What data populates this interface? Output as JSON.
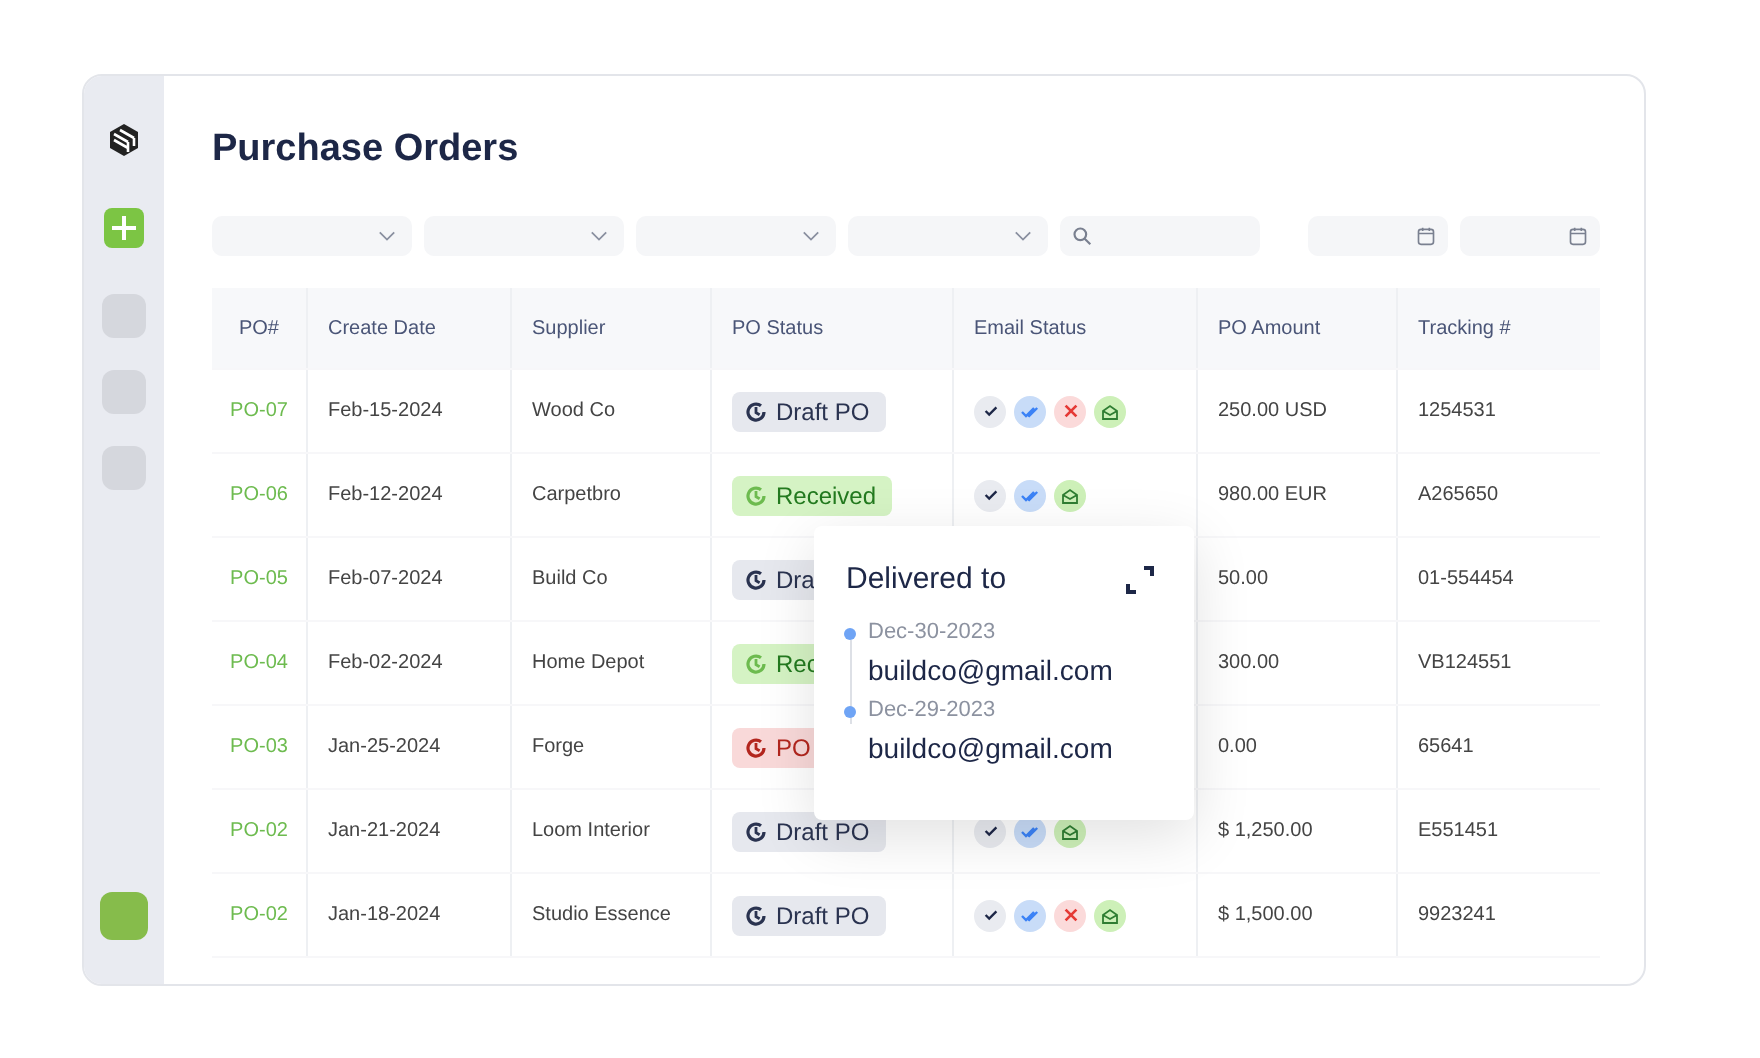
{
  "title": "Purchase Orders",
  "filters": [
    {
      "kind": "dropdown"
    },
    {
      "kind": "dropdown"
    },
    {
      "kind": "dropdown"
    },
    {
      "kind": "dropdown"
    },
    {
      "kind": "search"
    },
    {
      "kind": "date"
    },
    {
      "kind": "date"
    }
  ],
  "table": {
    "columns": [
      "PO#",
      "Create Date",
      "Supplier",
      "PO Status",
      "Email Status",
      "PO Amount",
      "Tracking #"
    ],
    "rows": [
      {
        "po": "PO-07",
        "date": "Feb-15-2024",
        "supplier": "Wood Co",
        "status": {
          "kind": "draft",
          "label": "Draft PO"
        },
        "email": [
          {
            "kind": "sent"
          },
          {
            "kind": "delivered"
          },
          {
            "kind": "failed"
          },
          {
            "kind": "opened"
          }
        ],
        "amount": "250.00 USD",
        "tracking": "1254531"
      },
      {
        "po": "PO-06",
        "date": "Feb-12-2024",
        "supplier": "Carpetbro",
        "status": {
          "kind": "received",
          "label": "Received"
        },
        "email": [
          {
            "kind": "sent"
          },
          {
            "kind": "delivered"
          },
          {
            "kind": "opened"
          }
        ],
        "amount": "980.00  EUR",
        "tracking": "A265650"
      },
      {
        "po": "PO-05",
        "date": "Feb-07-2024",
        "supplier": "Build Co",
        "status": {
          "kind": "draft",
          "label": "Dra"
        },
        "email": [],
        "amount": "50.00",
        "tracking": "01-554454"
      },
      {
        "po": "PO-04",
        "date": "Feb-02-2024",
        "supplier": "Home Depot",
        "status": {
          "kind": "received",
          "label": "Rec"
        },
        "email": [],
        "amount": "300.00",
        "tracking": "VB124551"
      },
      {
        "po": "PO-03",
        "date": "Jan-25-2024",
        "supplier": "Forge",
        "status": {
          "kind": "cancelled",
          "label": "PO"
        },
        "email": [],
        "amount": "0.00",
        "tracking": "65641"
      },
      {
        "po": "PO-02",
        "date": "Jan-21-2024",
        "supplier": "Loom Interior",
        "status": {
          "kind": "draft",
          "label": "Draft PO"
        },
        "email": [
          {
            "kind": "sent"
          },
          {
            "kind": "delivered"
          },
          {
            "kind": "opened"
          }
        ],
        "amount": "$ 1,250.00",
        "tracking": "E551451"
      },
      {
        "po": "PO-02",
        "date": "Jan-18-2024",
        "supplier": "Studio Essence",
        "status": {
          "kind": "draft",
          "label": "Draft PO"
        },
        "email": [
          {
            "kind": "sent"
          },
          {
            "kind": "delivered"
          },
          {
            "kind": "failed"
          },
          {
            "kind": "opened"
          }
        ],
        "amount": "$ 1,500.00",
        "tracking": "9923241"
      }
    ]
  },
  "popover": {
    "title": "Delivered to",
    "entries": [
      {
        "date": "Dec-30-2023",
        "email": "buildco@gmail.com"
      },
      {
        "date": "Dec-29-2023",
        "email": "buildco@gmail.com"
      }
    ]
  }
}
